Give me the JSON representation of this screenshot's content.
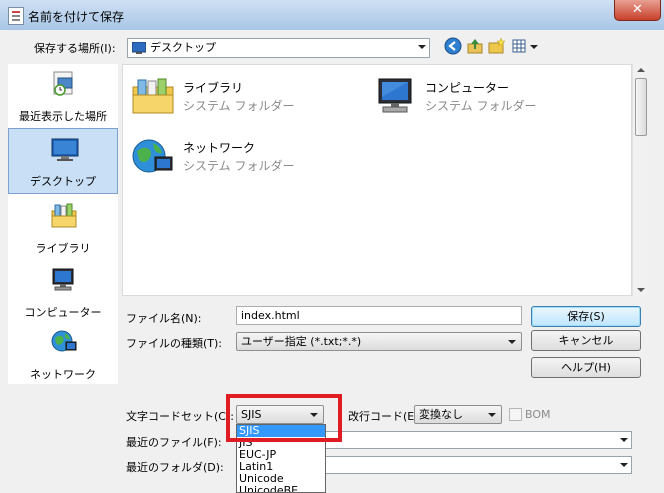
{
  "window": {
    "title": "名前を付けて保存",
    "close": "✕"
  },
  "save_in": {
    "label": "保存する場所(I):",
    "value": "デスクトップ"
  },
  "toolbar": {
    "back_icon": "back-arrow-icon",
    "up_icon": "up-folder-icon",
    "new_folder_icon": "new-folder-icon",
    "views_icon": "view-menu-icon"
  },
  "places": [
    {
      "label": "最近表示した場所",
      "icon": "recent-places-icon"
    },
    {
      "label": "デスクトップ",
      "icon": "desktop-icon",
      "selected": true
    },
    {
      "label": "ライブラリ",
      "icon": "libraries-icon"
    },
    {
      "label": "コンピューター",
      "icon": "computer-icon"
    },
    {
      "label": "ネットワーク",
      "icon": "network-icon"
    }
  ],
  "items": [
    {
      "name": "ライブラリ",
      "sub": "システム フォルダー",
      "icon": "library-folder-icon"
    },
    {
      "name": "コンピューター",
      "sub": "システム フォルダー",
      "icon": "computer-icon"
    },
    {
      "name": "ネットワーク",
      "sub": "システム フォルダー",
      "icon": "network-globe-icon"
    }
  ],
  "filename": {
    "label": "ファイル名(N):",
    "value": "index.html"
  },
  "filetype": {
    "label": "ファイルの種類(T):",
    "value": "ユーザー指定 (*.txt;*.*)"
  },
  "buttons": {
    "save": "保存(S)",
    "cancel": "キャンセル",
    "help": "ヘルプ(H)"
  },
  "encoding": {
    "label": "文字コードセット(C):",
    "value": "SJIS",
    "options": [
      "SJIS",
      "JIS",
      "EUC-JP",
      "Latin1",
      "Unicode",
      "UnicodeBE"
    ]
  },
  "newline": {
    "label": "改行コード(E):",
    "value": "変換なし"
  },
  "bom": {
    "label": "BOM",
    "checked": false
  },
  "recent_file": {
    "label": "最近のファイル(F):",
    "value": ""
  },
  "recent_folder": {
    "label": "最近のフォルダ(D):",
    "value": ""
  },
  "colors": {
    "accent": "#3399ff",
    "highlight_box": "#e01b24"
  }
}
